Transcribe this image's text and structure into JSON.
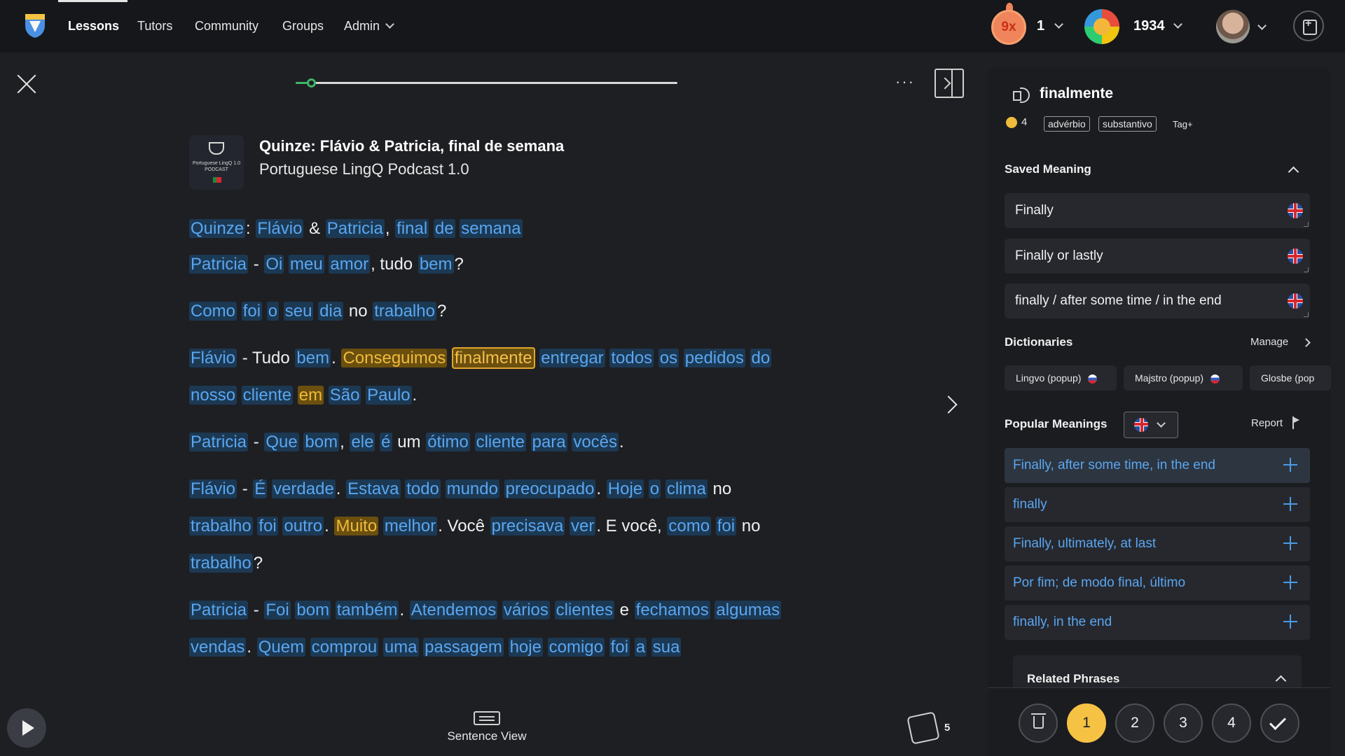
{
  "nav": {
    "items": [
      "Lessons",
      "Tutors",
      "Community",
      "Groups",
      "Admin"
    ],
    "streak": "9x",
    "streak_days": "1",
    "coins": "1934"
  },
  "reader": {
    "progress": 0.04,
    "lesson_title": "Quinze: Flávio & Patricia, final de semana",
    "course": "Portuguese LingQ Podcast 1.0",
    "cover_text": "Portuguese LingQ 1.0 PODCAST",
    "more": "···",
    "sentence_view": "Sentence View",
    "cards_count": "5"
  },
  "paragraphs": [
    [
      [
        "Quinze",
        "b"
      ],
      [
        ":",
        "p"
      ],
      [
        "Flávio",
        "b"
      ],
      [
        "&",
        "p"
      ],
      [
        "Patricia",
        "b"
      ],
      [
        ",",
        "p"
      ],
      [
        "final",
        "b"
      ],
      [
        "de",
        "b"
      ],
      [
        "semana",
        "b"
      ]
    ],
    [
      [
        "Patricia",
        "b"
      ],
      [
        "-",
        "p"
      ],
      [
        "Oi",
        "b"
      ],
      [
        "meu",
        "b"
      ],
      [
        "amor",
        "b"
      ],
      [
        ", tudo",
        "p"
      ],
      [
        "bem",
        "b"
      ],
      [
        "?",
        "p"
      ]
    ],
    [
      [
        "Como",
        "b"
      ],
      [
        "foi",
        "b"
      ],
      [
        "o",
        "b"
      ],
      [
        "seu",
        "b"
      ],
      [
        "dia",
        "b"
      ],
      [
        "no",
        "p"
      ],
      [
        "trabalho",
        "b"
      ],
      [
        "?",
        "p"
      ]
    ],
    [
      [
        "Flávio",
        "b"
      ],
      [
        "- Tudo",
        "p"
      ],
      [
        "bem",
        "b"
      ],
      [
        ".",
        "p"
      ],
      [
        "Conseguimos",
        "y"
      ],
      [
        "finalmente",
        "s"
      ],
      [
        "entregar",
        "b"
      ],
      [
        "todos",
        "b"
      ],
      [
        "os",
        "b"
      ],
      [
        "pedidos",
        "b"
      ],
      [
        "do",
        "b"
      ],
      [
        "nosso",
        "b"
      ],
      [
        "cliente",
        "b"
      ],
      [
        "em",
        "y"
      ],
      [
        "São",
        "b"
      ],
      [
        "Paulo",
        "b"
      ],
      [
        ".",
        "p"
      ]
    ],
    [
      [
        "Patricia",
        "b"
      ],
      [
        "-",
        "p"
      ],
      [
        "Que",
        "b"
      ],
      [
        "bom",
        "b"
      ],
      [
        ",",
        "p"
      ],
      [
        "ele",
        "b"
      ],
      [
        "é",
        "b"
      ],
      [
        "um",
        "p"
      ],
      [
        "ótimo",
        "b"
      ],
      [
        "cliente",
        "b"
      ],
      [
        "para",
        "b"
      ],
      [
        "vocês",
        "b"
      ],
      [
        ".",
        "p"
      ]
    ],
    [
      [
        "Flávio",
        "b"
      ],
      [
        "-",
        "p"
      ],
      [
        "É",
        "b"
      ],
      [
        "verdade",
        "b"
      ],
      [
        ".",
        "p"
      ],
      [
        "Estava",
        "b"
      ],
      [
        "todo",
        "b"
      ],
      [
        "mundo",
        "b"
      ],
      [
        "preocupado",
        "b"
      ],
      [
        ".",
        "p"
      ],
      [
        "Hoje",
        "b"
      ],
      [
        "o",
        "b"
      ],
      [
        "clima",
        "b"
      ],
      [
        "no",
        "p"
      ],
      [
        "trabalho",
        "b"
      ],
      [
        "foi",
        "b"
      ],
      [
        "outro",
        "b"
      ],
      [
        ".",
        "p"
      ],
      [
        "Muito",
        "y"
      ],
      [
        "melhor",
        "b"
      ],
      [
        ". Você",
        "p"
      ],
      [
        "precisava",
        "b"
      ],
      [
        "ver",
        "b"
      ],
      [
        ". E você,",
        "p"
      ],
      [
        "como",
        "b"
      ],
      [
        "foi",
        "b"
      ],
      [
        "no",
        "p"
      ],
      [
        "trabalho",
        "b"
      ],
      [
        "?",
        "p"
      ]
    ],
    [
      [
        "Patricia",
        "b"
      ],
      [
        "-",
        "p"
      ],
      [
        "Foi",
        "b"
      ],
      [
        "bom",
        "b"
      ],
      [
        "também",
        "b"
      ],
      [
        ".",
        "p"
      ],
      [
        "Atendemos",
        "b"
      ],
      [
        "vários",
        "b"
      ],
      [
        "clientes",
        "b"
      ],
      [
        "e",
        "p"
      ],
      [
        "fechamos",
        "b"
      ],
      [
        "algumas",
        "b"
      ],
      [
        "vendas",
        "b"
      ],
      [
        ".",
        "p"
      ],
      [
        "Quem",
        "b"
      ],
      [
        "comprou",
        "b"
      ],
      [
        "uma",
        "b"
      ],
      [
        "passagem",
        "b"
      ],
      [
        "hoje",
        "b"
      ],
      [
        "comigo",
        "b"
      ],
      [
        "foi",
        "b"
      ],
      [
        "a",
        "b"
      ],
      [
        "sua",
        "b"
      ]
    ]
  ],
  "panel": {
    "term": "finalmente",
    "status": "4",
    "tags": [
      "advérbio",
      "substantivo"
    ],
    "tag_add": "Tag+",
    "saved_meaning_title": "Saved Meaning",
    "saved_meanings": [
      "Finally",
      "Finally or lastly",
      "finally / after some time / in the end"
    ],
    "dictionaries_title": "Dictionaries",
    "manage": "Manage",
    "dictionaries": [
      "Lingvo (popup)",
      "Majstro (popup)",
      "Glosbe (pop"
    ],
    "popular_title": "Popular Meanings",
    "report": "Report",
    "popular": [
      "Finally, after some time, in the end",
      "finally",
      "Finally, ultimately, at last",
      "Por fim; de modo final, último",
      "finally, in the end"
    ],
    "related_title": "Related Phrases",
    "status_buttons": [
      "1",
      "2",
      "3",
      "4"
    ],
    "active_status": "1"
  }
}
